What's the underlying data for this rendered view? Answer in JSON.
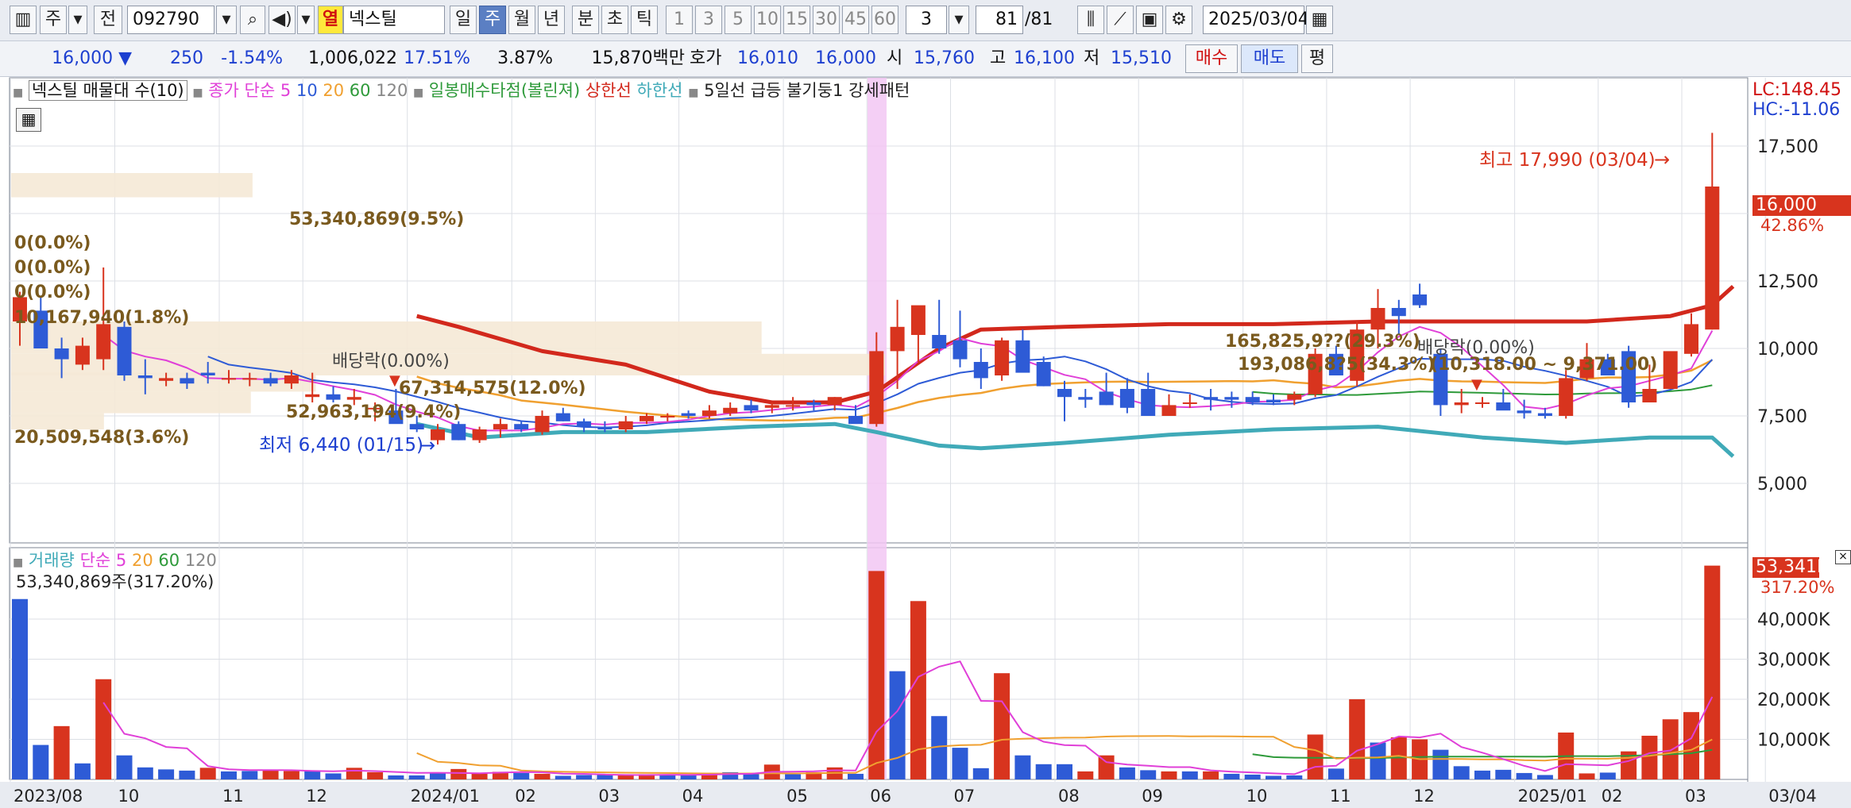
{
  "toolbar": {
    "market": "주",
    "prev_label": "전",
    "code": "092790",
    "name_prefix": "열",
    "stock_name": "넥스틸",
    "periods": [
      "일",
      "주",
      "월",
      "년",
      "분",
      "초",
      "틱"
    ],
    "active_period": "주",
    "intervals": [
      "1",
      "3",
      "5",
      "10",
      "15",
      "30",
      "45",
      "60"
    ],
    "interval_value": "3",
    "count": "81",
    "count_total": "/81",
    "date": "2025/03/04"
  },
  "quote": {
    "price": "16,000",
    "arrow": "▼",
    "change": "250",
    "change_pct": "-1.54%",
    "volume": "1,006,022",
    "turnover_pct": "17.51%",
    "other_pct": "3.87%",
    "amount": "15,870백만",
    "hoga_label": "호가",
    "bid": "16,010",
    "ask": "16,000",
    "open_label": "시",
    "open": "15,760",
    "high_label": "고",
    "high": "16,100",
    "low_label": "저",
    "low": "15,510",
    "buy_label": "매수",
    "sell_label": "매도",
    "flat_label": "평"
  },
  "legend_price": {
    "name": "넥스틸 매물대 수(10)",
    "ma_label": "종가 단순",
    "ma5": "5",
    "ma10": "10",
    "ma20": "20",
    "ma60": "60",
    "ma120": "120",
    "bollinger": "일봉매수타점(볼린져)",
    "upper": "상한선",
    "lower": "하한선",
    "pattern": "5일선 급등 불기둥1 강세패턴"
  },
  "legend_volume": {
    "name": "거래량",
    "ma_label": "단순",
    "ma5": "5",
    "ma20": "20",
    "ma60": "60",
    "ma120": "120",
    "summary": "53,340,869주(317.20%)"
  },
  "right_panel": {
    "lc": "LC:148.45",
    "hc": "HC:-11.06",
    "price_box": "16,000",
    "price_pct": "42.86%",
    "vol_box": "53,341K",
    "vol_pct": "317.20%"
  },
  "annotations": {
    "max_label": "최고 17,990 (03/04)",
    "min_label": "최저 6,440 (01/15)",
    "dividend1": "배당락(0.00%)",
    "dividend2": "배당락(0.00%)",
    "vp_labels": [
      "53,340,869(9.5%)",
      "0(0.0%)",
      "0(0.0%)",
      "0(0.0%)",
      "10,167,940(1.8%)",
      "67,314,575(12.0%)",
      "52,963,194(9.4%)",
      "20,509,548(3.6%)",
      "165,825,9??(29.3%)",
      "193,086,8?5(34.3%)"
    ],
    "range_label": "(10,318.00 ~ 9,371.00)"
  },
  "chart_data": {
    "type": "candlestick",
    "price_axis": {
      "ylim": [
        3500,
        19300
      ],
      "ticks": [
        5000,
        7500,
        10000,
        12500,
        17500
      ],
      "tick_labels": [
        "5,000",
        "7,500",
        "10,000",
        "12,500",
        "17,500"
      ]
    },
    "volume_axis": {
      "ylim": [
        0,
        52000
      ],
      "ticks": [
        10000,
        20000,
        30000,
        40000
      ],
      "tick_labels": [
        "10,000K",
        "20,000K",
        "30,000K",
        "40,000K"
      ]
    },
    "x_labels": [
      {
        "i": 0,
        "label": "2023/08"
      },
      {
        "i": 5,
        "label": "10"
      },
      {
        "i": 10,
        "label": "11"
      },
      {
        "i": 14,
        "label": "12"
      },
      {
        "i": 19,
        "label": "2024/01"
      },
      {
        "i": 24,
        "label": "02"
      },
      {
        "i": 28,
        "label": "03"
      },
      {
        "i": 32,
        "label": "04"
      },
      {
        "i": 37,
        "label": "05"
      },
      {
        "i": 41,
        "label": "06"
      },
      {
        "i": 45,
        "label": "07"
      },
      {
        "i": 50,
        "label": "08"
      },
      {
        "i": 54,
        "label": "09"
      },
      {
        "i": 59,
        "label": "10"
      },
      {
        "i": 63,
        "label": "11"
      },
      {
        "i": 67,
        "label": "12"
      },
      {
        "i": 72,
        "label": "2025/01"
      },
      {
        "i": 76,
        "label": "02"
      },
      {
        "i": 80,
        "label": "03"
      },
      {
        "i": 84,
        "label": "03/04"
      }
    ],
    "candles": [
      [
        11000,
        12100,
        10100,
        11900
      ],
      [
        11400,
        11900,
        10000,
        10000
      ],
      [
        10000,
        10400,
        8900,
        9600
      ],
      [
        9400,
        10400,
        9200,
        10100
      ],
      [
        9600,
        13000,
        9200,
        10900
      ],
      [
        10800,
        11000,
        8800,
        9000
      ],
      [
        9000,
        9600,
        8300,
        8900
      ],
      [
        8800,
        9100,
        8600,
        8900
      ],
      [
        8900,
        9100,
        8500,
        8700
      ],
      [
        9100,
        9500,
        8700,
        9000
      ],
      [
        8900,
        9200,
        8700,
        8900
      ],
      [
        8900,
        9100,
        8600,
        8900
      ],
      [
        8900,
        9100,
        8600,
        8700
      ],
      [
        8700,
        9200,
        8500,
        9000
      ],
      [
        8200,
        9100,
        8000,
        8300
      ],
      [
        8300,
        8600,
        8000,
        8100
      ],
      [
        8100,
        8500,
        7900,
        8200
      ],
      [
        7800,
        8000,
        7300,
        7800
      ],
      [
        7700,
        8500,
        7400,
        7200
      ],
      [
        7200,
        7500,
        6900,
        7000
      ],
      [
        6600,
        7200,
        6440,
        7000
      ],
      [
        7200,
        7300,
        6600,
        6600
      ],
      [
        6600,
        7100,
        6500,
        7000
      ],
      [
        7000,
        7400,
        6700,
        7200
      ],
      [
        7200,
        7300,
        6900,
        7000
      ],
      [
        6900,
        7700,
        6800,
        7500
      ],
      [
        7600,
        7800,
        7300,
        7300
      ],
      [
        7300,
        7400,
        6900,
        7100
      ],
      [
        7100,
        7300,
        6900,
        7000
      ],
      [
        7000,
        7500,
        6900,
        7300
      ],
      [
        7300,
        7600,
        7200,
        7500
      ],
      [
        7500,
        7600,
        7300,
        7500
      ],
      [
        7600,
        7700,
        7400,
        7500
      ],
      [
        7500,
        7900,
        7400,
        7700
      ],
      [
        7600,
        8000,
        7500,
        7800
      ],
      [
        7900,
        8100,
        7600,
        7700
      ],
      [
        7800,
        8000,
        7600,
        7900
      ],
      [
        7900,
        8200,
        7700,
        7900
      ],
      [
        8000,
        8100,
        7700,
        7900
      ],
      [
        7900,
        8200,
        7700,
        8200
      ],
      [
        7500,
        7900,
        7300,
        7200
      ],
      [
        7200,
        10600,
        7100,
        9900
      ],
      [
        9900,
        11800,
        8500,
        10800
      ],
      [
        10500,
        11400,
        9500,
        11600
      ],
      [
        10500,
        11800,
        9800,
        10000
      ],
      [
        10300,
        11400,
        9300,
        9600
      ],
      [
        9500,
        10000,
        8500,
        8900
      ],
      [
        9000,
        10400,
        8800,
        10300
      ],
      [
        10300,
        10700,
        9200,
        9100
      ],
      [
        9500,
        9700,
        8600,
        8600
      ],
      [
        8500,
        8800,
        7300,
        8200
      ],
      [
        8200,
        8500,
        7800,
        8100
      ],
      [
        8400,
        9100,
        7900,
        7900
      ],
      [
        8500,
        8900,
        7600,
        7800
      ],
      [
        8500,
        9100,
        7700,
        7500
      ],
      [
        7500,
        8300,
        7500,
        7900
      ],
      [
        8000,
        8300,
        7800,
        8000
      ],
      [
        8200,
        8500,
        7700,
        8100
      ],
      [
        8200,
        8400,
        7800,
        8100
      ],
      [
        8200,
        8400,
        7900,
        8000
      ],
      [
        8100,
        8300,
        7900,
        8000
      ],
      [
        8100,
        8400,
        7900,
        8300
      ],
      [
        8300,
        10000,
        8200,
        9800
      ],
      [
        9800,
        10100,
        9100,
        9000
      ],
      [
        8800,
        11000,
        8600,
        10700
      ],
      [
        10700,
        12200,
        10000,
        11500
      ],
      [
        11500,
        11800,
        10500,
        11200
      ],
      [
        12000,
        12400,
        11500,
        11600
      ],
      [
        9800,
        10000,
        7500,
        7900
      ],
      [
        7900,
        8500,
        7600,
        8000
      ],
      [
        8000,
        8200,
        7800,
        8000
      ],
      [
        8000,
        8500,
        7800,
        7700
      ],
      [
        7700,
        8100,
        7400,
        7600
      ],
      [
        7600,
        7800,
        7400,
        7500
      ],
      [
        7500,
        9200,
        7400,
        8900
      ],
      [
        8900,
        10200,
        8800,
        9600
      ],
      [
        9600,
        9800,
        9100,
        9000
      ],
      [
        9900,
        10100,
        7800,
        8000
      ],
      [
        8000,
        9400,
        8000,
        8500
      ],
      [
        8500,
        9800,
        8500,
        9900
      ],
      [
        9800,
        11300,
        9700,
        10900
      ],
      [
        10700,
        17990,
        10700,
        16000
      ]
    ],
    "volume": [
      [
        45000,
        "d"
      ],
      [
        8600,
        "d"
      ],
      [
        13300,
        "u"
      ],
      [
        4000,
        "d"
      ],
      [
        25000,
        "u"
      ],
      [
        6000,
        "d"
      ],
      [
        3000,
        "d"
      ],
      [
        2500,
        "d"
      ],
      [
        2200,
        "d"
      ],
      [
        2900,
        "u"
      ],
      [
        2000,
        "d"
      ],
      [
        2100,
        "d"
      ],
      [
        2400,
        "u"
      ],
      [
        2100,
        "u"
      ],
      [
        2100,
        "d"
      ],
      [
        1500,
        "d"
      ],
      [
        2900,
        "u"
      ],
      [
        1800,
        "u"
      ],
      [
        1000,
        "d"
      ],
      [
        1000,
        "d"
      ],
      [
        1600,
        "d"
      ],
      [
        2600,
        "u"
      ],
      [
        1400,
        "u"
      ],
      [
        1900,
        "u"
      ],
      [
        1600,
        "d"
      ],
      [
        1400,
        "u"
      ],
      [
        900,
        "d"
      ],
      [
        1100,
        "d"
      ],
      [
        1100,
        "d"
      ],
      [
        1000,
        "u"
      ],
      [
        1300,
        "u"
      ],
      [
        1300,
        "d"
      ],
      [
        1000,
        "d"
      ],
      [
        1300,
        "u"
      ],
      [
        1800,
        "d"
      ],
      [
        1600,
        "d"
      ],
      [
        3700,
        "u"
      ],
      [
        1300,
        "d"
      ],
      [
        1800,
        "u"
      ],
      [
        3000,
        "u"
      ],
      [
        1400,
        "d"
      ],
      [
        52000,
        "u"
      ],
      [
        27000,
        "d"
      ],
      [
        44500,
        "u"
      ],
      [
        15800,
        "d"
      ],
      [
        7900,
        "d"
      ],
      [
        2800,
        "d"
      ],
      [
        26500,
        "u"
      ],
      [
        6000,
        "d"
      ],
      [
        3800,
        "d"
      ],
      [
        3800,
        "d"
      ],
      [
        2000,
        "u"
      ],
      [
        6000,
        "u"
      ],
      [
        3000,
        "d"
      ],
      [
        2300,
        "d"
      ],
      [
        2000,
        "u"
      ],
      [
        2000,
        "d"
      ],
      [
        2000,
        "u"
      ],
      [
        1400,
        "d"
      ],
      [
        1200,
        "d"
      ],
      [
        900,
        "d"
      ],
      [
        1000,
        "d"
      ],
      [
        11200,
        "u"
      ],
      [
        2700,
        "d"
      ],
      [
        20000,
        "u"
      ],
      [
        9200,
        "d"
      ],
      [
        10500,
        "u"
      ],
      [
        10000,
        "u"
      ],
      [
        7400,
        "d"
      ],
      [
        3300,
        "d"
      ],
      [
        2200,
        "d"
      ],
      [
        2400,
        "d"
      ],
      [
        1600,
        "d"
      ],
      [
        1100,
        "d"
      ],
      [
        11700,
        "u"
      ],
      [
        1500,
        "u"
      ],
      [
        1700,
        "d"
      ],
      [
        7000,
        "u"
      ],
      [
        10900,
        "u"
      ],
      [
        15000,
        "u"
      ],
      [
        16800,
        "u"
      ],
      [
        53341,
        "u"
      ]
    ],
    "vp_bands": [
      {
        "low": 15600,
        "high": 16500,
        "volume": 53340869
      },
      {
        "low": 9800,
        "high": 11000,
        "volume": 165825900
      },
      {
        "low": 9000,
        "high": 9800,
        "volume": 193086805
      },
      {
        "low": 8400,
        "high": 9100,
        "volume": 67314575
      },
      {
        "low": 7600,
        "high": 8400,
        "volume": 52963194
      },
      {
        "low": 7000,
        "high": 7600,
        "volume": 20509548
      }
    ],
    "series": {
      "bb_upper": [
        [
          19,
          11200
        ],
        [
          21,
          10800
        ],
        [
          25,
          9900
        ],
        [
          29,
          9400
        ],
        [
          33,
          8400
        ],
        [
          36,
          8000
        ],
        [
          39,
          8000
        ],
        [
          41,
          8400
        ],
        [
          44,
          10000
        ],
        [
          46,
          10700
        ],
        [
          50,
          10800
        ],
        [
          55,
          10900
        ],
        [
          60,
          10900
        ],
        [
          65,
          11000
        ],
        [
          70,
          11000
        ],
        [
          75,
          11000
        ],
        [
          79,
          11200
        ],
        [
          81,
          11600
        ],
        [
          82,
          12300
        ]
      ],
      "bb_lower": [
        [
          19,
          7200
        ],
        [
          22,
          6700
        ],
        [
          26,
          6900
        ],
        [
          30,
          6900
        ],
        [
          35,
          7100
        ],
        [
          39,
          7200
        ],
        [
          41,
          6900
        ],
        [
          44,
          6400
        ],
        [
          46,
          6300
        ],
        [
          50,
          6500
        ],
        [
          55,
          6800
        ],
        [
          60,
          7000
        ],
        [
          65,
          7100
        ],
        [
          70,
          6700
        ],
        [
          74,
          6500
        ],
        [
          78,
          6700
        ],
        [
          81,
          6700
        ],
        [
          82,
          6000
        ]
      ]
    },
    "colors": {
      "up": "#d8341e",
      "down": "#2e5bd6",
      "upper": "#d2281c",
      "lower": "#40aab8",
      "ma5": "#e040d8",
      "ma20": "#f0a030",
      "ma60": "#2e9a3a"
    }
  }
}
